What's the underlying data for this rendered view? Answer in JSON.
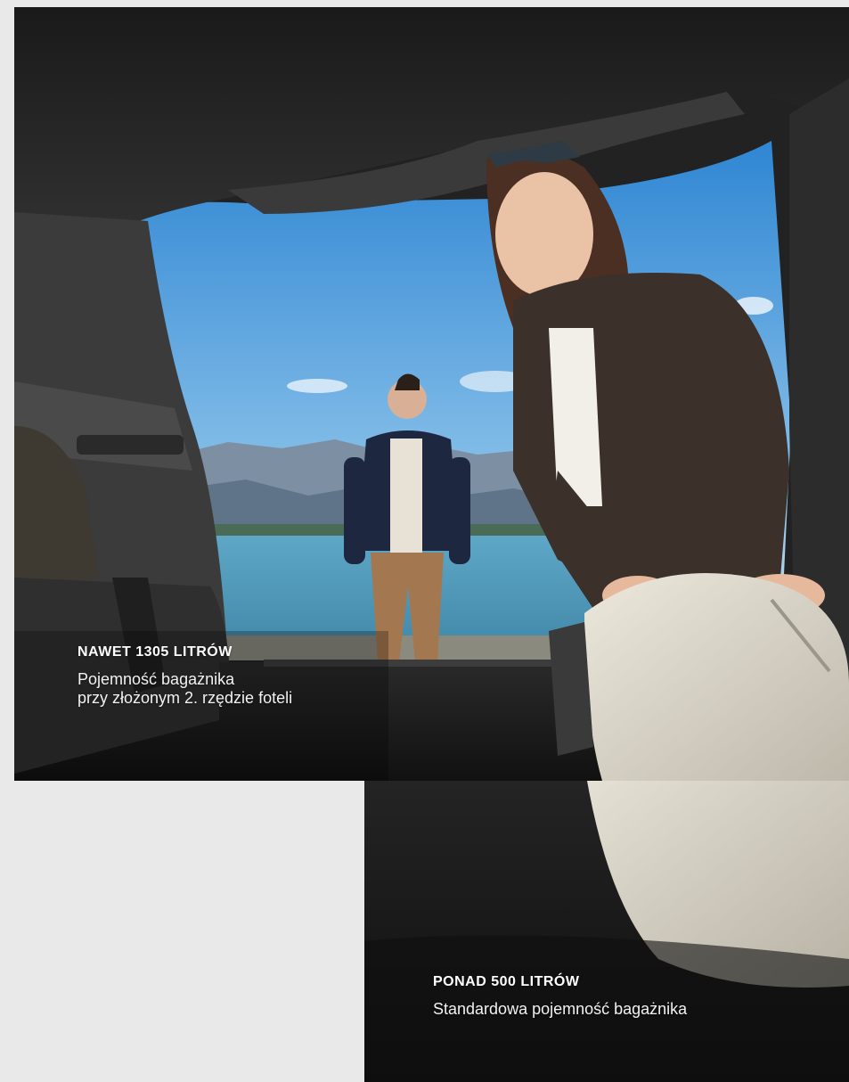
{
  "features": [
    {
      "headline": "NAWET 1305 LITRÓW",
      "description_lines": [
        "Pojemność bagażnika",
        "przy złożonym 2. rzędzie foteli"
      ]
    },
    {
      "headline": "PONAD 500 LITRÓW",
      "description_lines": [
        "Standardowa pojemność bagażnika"
      ]
    }
  ],
  "colors": {
    "page_background": "#e9e9e9",
    "caption_text": "#ffffff",
    "sky": "#5aa6df",
    "water": "#4f97b8",
    "trunk_interior": "#1c1c1c"
  }
}
